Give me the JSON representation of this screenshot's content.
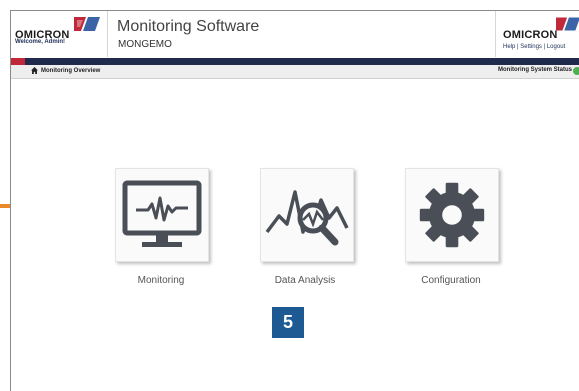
{
  "header": {
    "brand": "OMICRON",
    "welcome": "Welcome, Admin!",
    "title": "Monitoring Software",
    "subtitle": "MONGEMO",
    "right_brand": "OMICRON",
    "links": [
      "Help",
      "Settings",
      "Logout"
    ]
  },
  "navbar": {
    "breadcrumb": "Monitoring Overview",
    "status_label": "Monitoring System Status"
  },
  "tiles": [
    {
      "label": "Monitoring",
      "icon": "monitor-waveform-icon"
    },
    {
      "label": "Data Analysis",
      "icon": "waveform-magnifier-icon"
    },
    {
      "label": "Configuration",
      "icon": "gear-icon"
    }
  ],
  "badge": "5",
  "colors": {
    "band": "#1f2a4d",
    "brand_red": "#c0293a",
    "icon_gray": "#4a4f57",
    "badge_blue": "#1d5a94",
    "status_green": "#4caf50",
    "side_tab_orange": "#e98a2a"
  }
}
